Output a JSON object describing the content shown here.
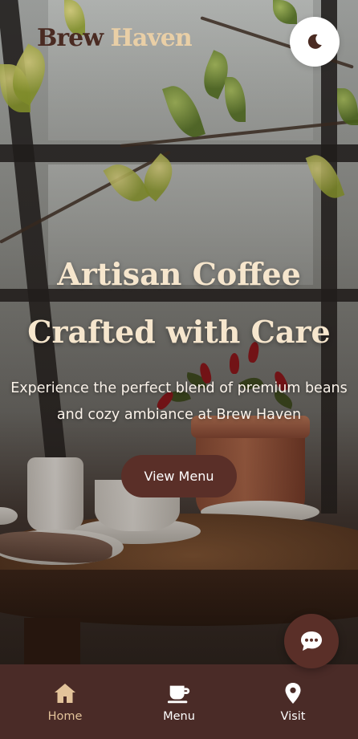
{
  "brand": {
    "name_part1": "Brew",
    "name_part2": "Haven"
  },
  "header": {
    "theme_toggle_icon": "moon-icon"
  },
  "hero": {
    "title_line1": "Artisan Coffee",
    "title_line2": "Crafted with Care",
    "subtitle": "Experience the perfect blend of premium beans and cozy ambiance at Brew Haven",
    "cta_label": "View Menu"
  },
  "chat": {
    "icon": "chat-bubble-icon"
  },
  "bottom_nav": {
    "items": [
      {
        "label": "Home",
        "icon": "home-icon",
        "active": true
      },
      {
        "label": "Menu",
        "icon": "coffee-cup-icon",
        "active": false
      },
      {
        "label": "Visit",
        "icon": "map-pin-icon",
        "active": false
      }
    ]
  },
  "colors": {
    "brand_dark": "#4a2b22",
    "brand_light": "#e9cfa6",
    "accent": "#5a2f28",
    "nav_bg": "#4a2b27",
    "nav_active": "#e3c39a"
  }
}
